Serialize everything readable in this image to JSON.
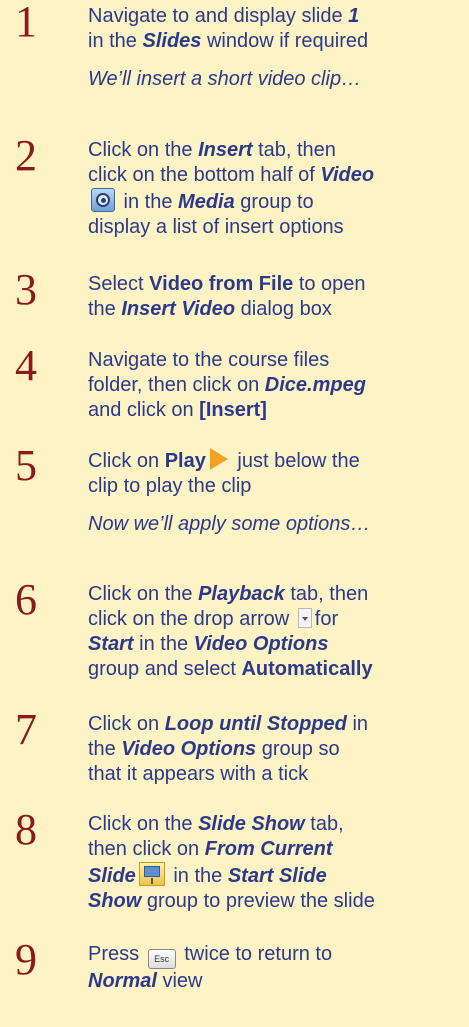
{
  "steps": [
    {
      "num": "1"
    },
    {
      "num": "2"
    },
    {
      "num": "3"
    },
    {
      "num": "4"
    },
    {
      "num": "5"
    },
    {
      "num": "6"
    },
    {
      "num": "7"
    },
    {
      "num": "8"
    },
    {
      "num": "9"
    }
  ],
  "s1": {
    "a": "Navigate to and display slide ",
    "b": "1",
    "c": "in the ",
    "d": "Slides",
    "e": " window if required",
    "note": "We’ll insert a short video clip…"
  },
  "s2": {
    "a": "Click on the ",
    "b": "Insert",
    "c": " tab, then",
    "d": "click on the bottom half of ",
    "e": "Video",
    "f": " in the ",
    "g": "Media",
    "h": " group to",
    "i": "display a list of insert options"
  },
  "s3": {
    "a": "Select ",
    "b": "Video from File",
    "c": " to open",
    "d": "the ",
    "e": "Insert Video",
    "f": " dialog box"
  },
  "s4": {
    "a": "Navigate to the course files",
    "b": "folder, then click on ",
    "c": "Dice.mpeg",
    "d": "and click on ",
    "e": "[Insert]"
  },
  "s5": {
    "a": "Click on ",
    "b": "Play",
    "c": " just below the",
    "d": "clip to play the clip",
    "note": "Now we’ll apply some options…"
  },
  "s6": {
    "a": "Click on the ",
    "b": "Playback",
    "c": " tab, then",
    "d": "click on the drop arrow ",
    "e": "for",
    "f": "Start",
    "g": " in the ",
    "h": "Video Options",
    "i": "group and select ",
    "j": "Automatically"
  },
  "s7": {
    "a": "Click on ",
    "b": "Loop until Stopped",
    "c": " in",
    "d": "the ",
    "e": "Video Options",
    "f": " group so",
    "g": "that it appears with a tick"
  },
  "s8": {
    "a": "Click on the ",
    "b": "Slide Show",
    "c": " tab,",
    "d": "then click on ",
    "e": "From Current",
    "f": "Slide",
    "g": " in the ",
    "h": "Start Slide",
    "i": "Show",
    "j": " group to preview the slide"
  },
  "s9": {
    "a": "Press ",
    "b": " twice to return to",
    "c": "Normal",
    "d": " view",
    "esc": "Esc"
  },
  "colors": {
    "background": "#fdf3c4",
    "text": "#2b3a8c",
    "step_number": "#8b1a1a"
  },
  "icons": [
    "video-icon",
    "play-icon",
    "drop-arrow-icon",
    "from-current-slide-icon",
    "esc-key-icon"
  ]
}
